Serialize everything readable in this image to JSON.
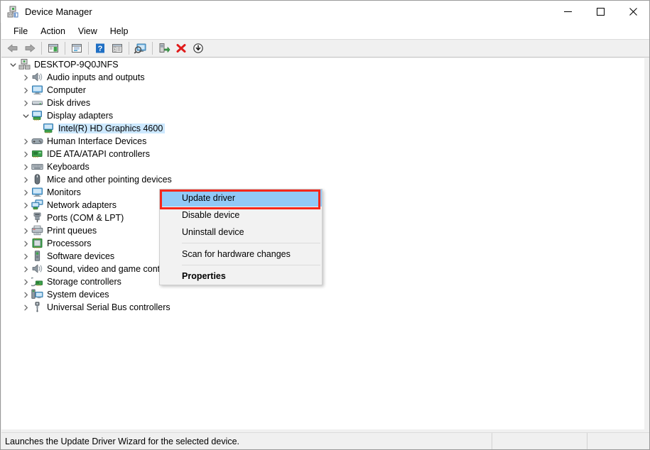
{
  "window": {
    "title": "Device Manager",
    "icon": "device-manager-icon",
    "controls": {
      "minimize": "minimize-icon",
      "maximize": "maximize-icon",
      "close": "close-icon"
    }
  },
  "menubar": {
    "items": [
      {
        "label": "File"
      },
      {
        "label": "Action"
      },
      {
        "label": "View"
      },
      {
        "label": "Help"
      }
    ]
  },
  "toolbar": {
    "buttons": [
      {
        "name": "back-icon"
      },
      {
        "name": "forward-icon"
      },
      {
        "name": "show-hide-console-tree-icon"
      },
      {
        "name": "properties-icon"
      },
      {
        "name": "help-icon"
      },
      {
        "name": "show-hide-action-pane-icon"
      },
      {
        "name": "scan-for-hardware-changes-icon"
      },
      {
        "name": "update-driver-icon"
      },
      {
        "name": "uninstall-device-icon"
      },
      {
        "name": "disable-device-icon"
      }
    ]
  },
  "tree": {
    "root": {
      "label": "DESKTOP-9Q0JNFS",
      "icon": "computer-root-icon",
      "expanded": true
    },
    "items": [
      {
        "label": "Audio inputs and outputs",
        "icon": "speaker-icon",
        "expanded": false,
        "depth": 1,
        "selected": false
      },
      {
        "label": "Computer",
        "icon": "monitor-icon",
        "expanded": false,
        "depth": 1,
        "selected": false
      },
      {
        "label": "Disk drives",
        "icon": "disk-drive-icon",
        "expanded": false,
        "depth": 1,
        "selected": false
      },
      {
        "label": "Display adapters",
        "icon": "display-adapter-icon",
        "expanded": true,
        "depth": 1,
        "selected": false
      },
      {
        "label": "Intel(R) HD Graphics 4600",
        "icon": "display-adapter-icon",
        "expanded": null,
        "depth": 2,
        "selected": true
      },
      {
        "label": "Human Interface Devices",
        "icon": "hid-icon",
        "expanded": false,
        "depth": 1,
        "selected": false
      },
      {
        "label": "IDE ATA/ATAPI controllers",
        "icon": "ide-controller-icon",
        "expanded": false,
        "depth": 1,
        "selected": false
      },
      {
        "label": "Keyboards",
        "icon": "keyboard-icon",
        "expanded": false,
        "depth": 1,
        "selected": false
      },
      {
        "label": "Mice and other pointing devices",
        "icon": "mouse-icon",
        "expanded": false,
        "depth": 1,
        "selected": false
      },
      {
        "label": "Monitors",
        "icon": "monitor-icon",
        "expanded": false,
        "depth": 1,
        "selected": false
      },
      {
        "label": "Network adapters",
        "icon": "network-adapter-icon",
        "expanded": false,
        "depth": 1,
        "selected": false
      },
      {
        "label": "Ports (COM & LPT)",
        "icon": "port-icon",
        "expanded": false,
        "depth": 1,
        "selected": false
      },
      {
        "label": "Print queues",
        "icon": "printer-icon",
        "expanded": false,
        "depth": 1,
        "selected": false
      },
      {
        "label": "Processors",
        "icon": "processor-icon",
        "expanded": false,
        "depth": 1,
        "selected": false
      },
      {
        "label": "Software devices",
        "icon": "software-device-icon",
        "expanded": false,
        "depth": 1,
        "selected": false
      },
      {
        "label": "Sound, video and game controllers",
        "icon": "speaker-icon",
        "expanded": false,
        "depth": 1,
        "selected": false
      },
      {
        "label": "Storage controllers",
        "icon": "storage-controller-icon",
        "expanded": false,
        "depth": 1,
        "selected": false
      },
      {
        "label": "System devices",
        "icon": "system-device-icon",
        "expanded": false,
        "depth": 1,
        "selected": false
      },
      {
        "label": "Universal Serial Bus controllers",
        "icon": "usb-icon",
        "expanded": false,
        "depth": 1,
        "selected": false
      }
    ]
  },
  "context_menu": {
    "items": [
      {
        "label": "Update driver",
        "highlighted": true,
        "bold": false
      },
      {
        "label": "Disable device",
        "highlighted": false,
        "bold": false
      },
      {
        "label": "Uninstall device",
        "highlighted": false,
        "bold": false
      },
      {
        "label": "Scan for hardware changes",
        "highlighted": false,
        "bold": false
      },
      {
        "label": "Properties",
        "highlighted": false,
        "bold": true
      }
    ]
  },
  "statusbar": {
    "message": "Launches the Update Driver Wizard for the selected device.",
    "pane2": "",
    "pane3": ""
  },
  "colors": {
    "selection_blue": "#cce8ff",
    "menu_highlight_blue": "#91c9f7",
    "annotation_red": "#f5271b",
    "chrome_gray": "#f0f0f0"
  }
}
